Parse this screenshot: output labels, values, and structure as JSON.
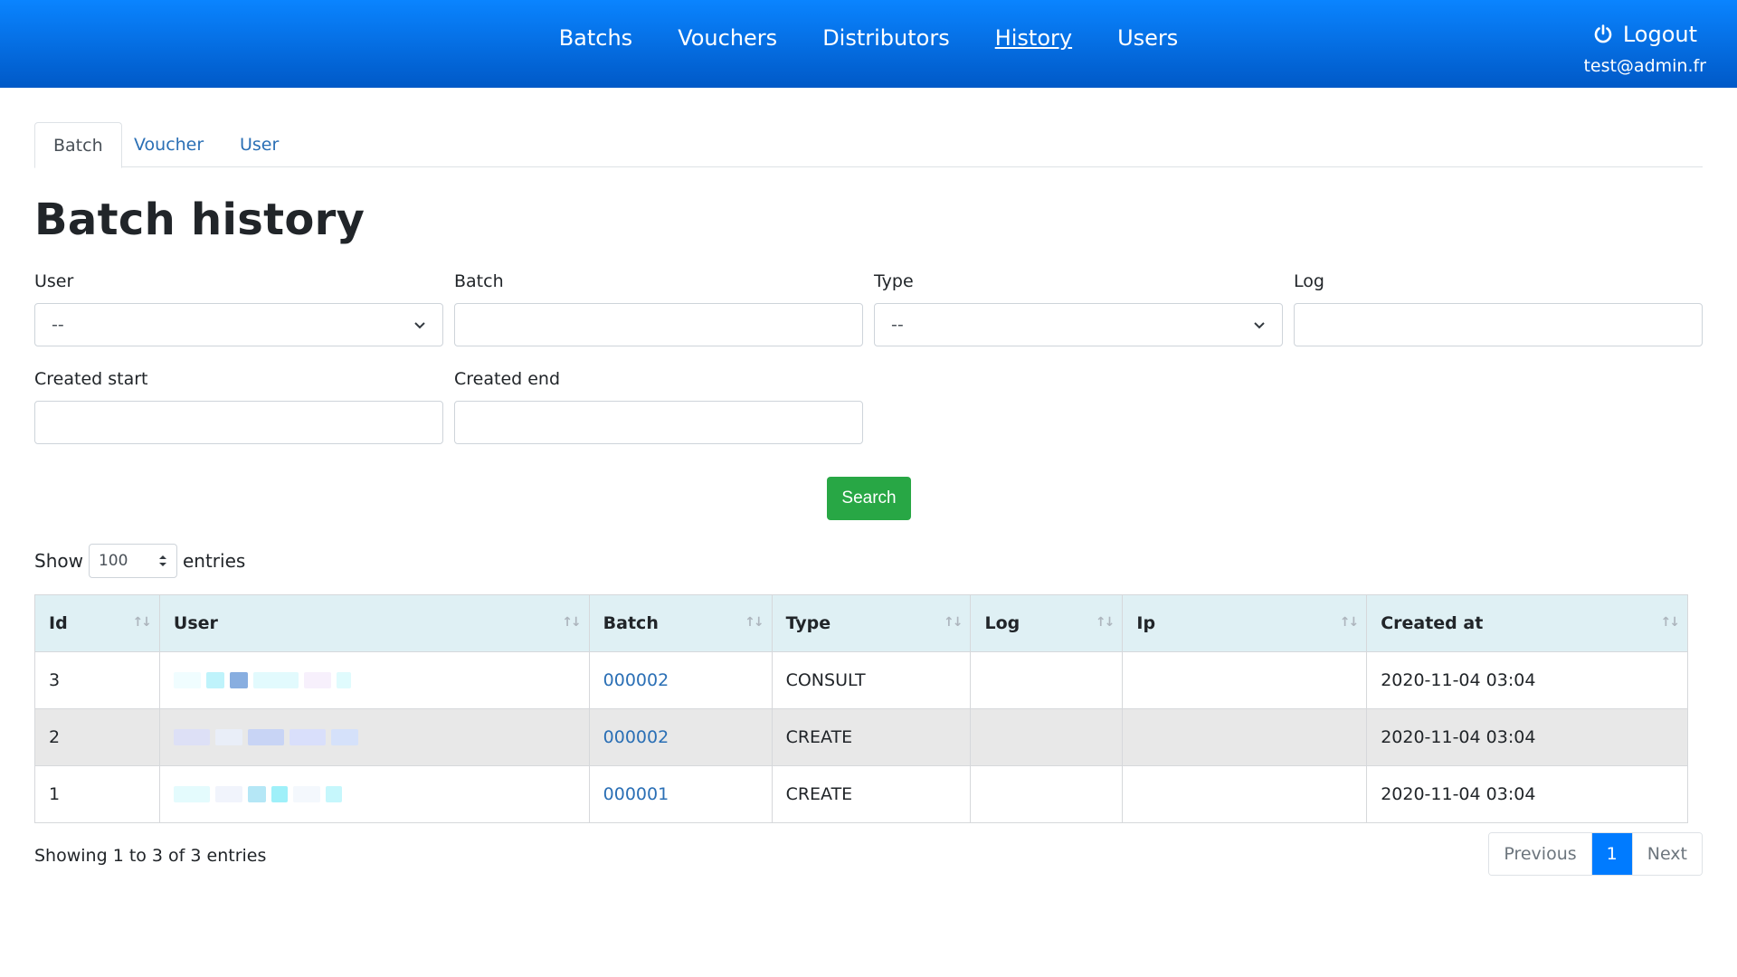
{
  "nav": {
    "links": [
      "Batchs",
      "Vouchers",
      "Distributors",
      "History",
      "Users"
    ],
    "active": "History",
    "logout_label": "Logout",
    "user_email": "test@admin.fr"
  },
  "tabs": [
    {
      "label": "Batch",
      "active": true
    },
    {
      "label": "Voucher",
      "active": false
    },
    {
      "label": "User",
      "active": false
    }
  ],
  "page_title": "Batch history",
  "filters": {
    "user": {
      "label": "User",
      "value": "--"
    },
    "batch": {
      "label": "Batch",
      "value": ""
    },
    "type": {
      "label": "Type",
      "value": "--"
    },
    "log": {
      "label": "Log",
      "value": ""
    },
    "created_start": {
      "label": "Created start",
      "value": ""
    },
    "created_end": {
      "label": "Created end",
      "value": ""
    }
  },
  "search_label": "Search",
  "show_entries": {
    "prefix": "Show",
    "value": "100",
    "suffix": "entries"
  },
  "table": {
    "columns": [
      "Id",
      "User",
      "Batch",
      "Type",
      "Log",
      "Ip",
      "Created at"
    ],
    "rows": [
      {
        "id": "3",
        "user": "",
        "batch": "000002",
        "type": "CONSULT",
        "log": "",
        "ip": "",
        "created_at": "2020-11-04 03:04"
      },
      {
        "id": "2",
        "user": "",
        "batch": "000002",
        "type": "CREATE",
        "log": "",
        "ip": "",
        "created_at": "2020-11-04 03:04"
      },
      {
        "id": "1",
        "user": "",
        "batch": "000001",
        "type": "CREATE",
        "log": "",
        "ip": "",
        "created_at": "2020-11-04 03:04"
      }
    ]
  },
  "info_text": "Showing 1 to 3 of 3 entries",
  "pagination": {
    "previous": "Previous",
    "current": "1",
    "next": "Next"
  },
  "colors": {
    "navbar": "#0a84ff",
    "search_button": "#28a745",
    "link": "#2a6fb5",
    "active_page": "#007bff",
    "table_header": "#dff0f4"
  }
}
